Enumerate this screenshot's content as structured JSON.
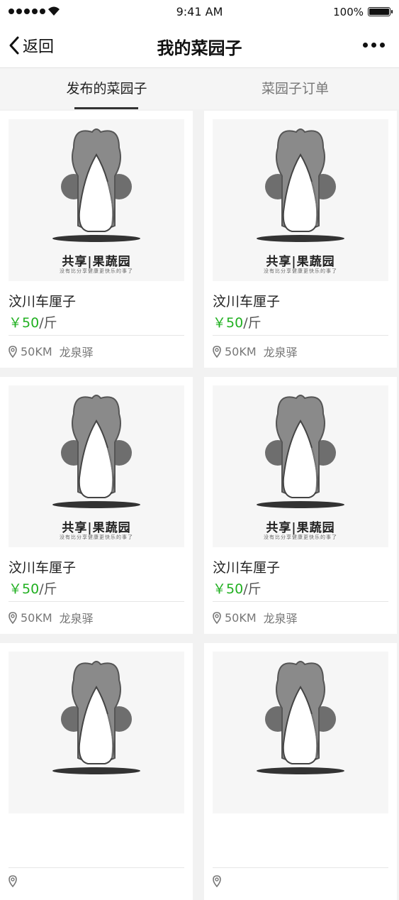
{
  "status_bar": {
    "time": "9:41 AM",
    "battery": "100%"
  },
  "navbar": {
    "back_label": "返回",
    "title": "我的菜园子"
  },
  "tabs": [
    {
      "label": "发布的菜园子",
      "active": true
    },
    {
      "label": "菜园子订单",
      "active": false
    }
  ],
  "items": [
    {
      "image_title": "共享|果蔬园",
      "image_subtitle": "没有比分享健康更快乐的事了",
      "name": "汶川车厘子",
      "price": "￥50",
      "unit": "/斤",
      "distance": "50KM",
      "location": "龙泉驿"
    },
    {
      "image_title": "共享|果蔬园",
      "image_subtitle": "没有比分享健康更快乐的事了",
      "name": "汶川车厘子",
      "price": "￥50",
      "unit": "/斤",
      "distance": "50KM",
      "location": "龙泉驿"
    },
    {
      "image_title": "共享|果蔬园",
      "image_subtitle": "没有比分享健康更快乐的事了",
      "name": "汶川车厘子",
      "price": "￥50",
      "unit": "/斤",
      "distance": "50KM",
      "location": "龙泉驿"
    },
    {
      "image_title": "共享|果蔬园",
      "image_subtitle": "没有比分享健康更快乐的事了",
      "name": "汶川车厘子",
      "price": "￥50",
      "unit": "/斤",
      "distance": "50KM",
      "location": "龙泉驿"
    },
    {
      "image_title": "",
      "image_subtitle": "",
      "name": "",
      "price": "",
      "unit": "",
      "distance": "",
      "location": ""
    },
    {
      "image_title": "",
      "image_subtitle": "",
      "name": "",
      "price": "",
      "unit": "",
      "distance": "",
      "location": ""
    }
  ],
  "colors": {
    "price": "#21b021",
    "background": "#f2f2f2"
  }
}
